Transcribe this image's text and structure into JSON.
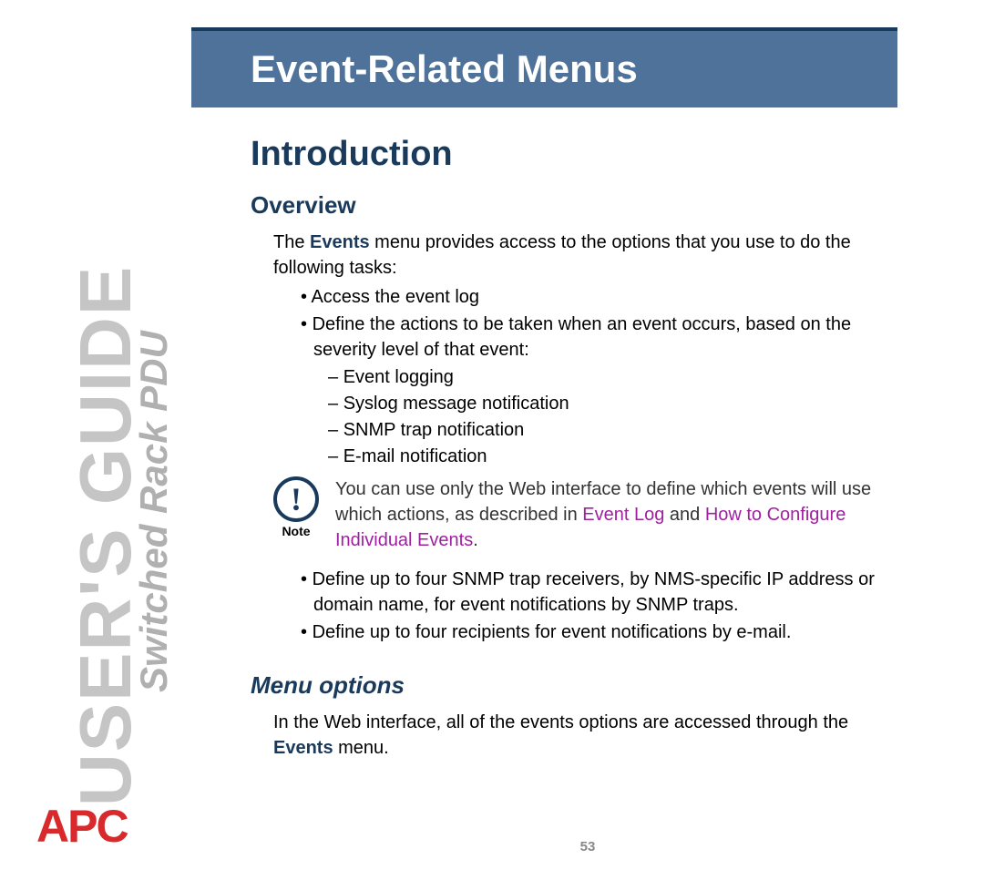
{
  "sidebar": {
    "title_large": "USER'S GUIDE",
    "title_small": "Switched Rack PDU",
    "logo_text": "APC"
  },
  "header": {
    "banner_title": "Event-Related Menus"
  },
  "section": {
    "title": "Introduction",
    "overview_heading": "Overview",
    "overview_intro_prefix": "The ",
    "overview_intro_bold": "Events",
    "overview_intro_suffix": " menu provides access to the options that you use to do the following tasks:",
    "bullets": {
      "b1": "Access the event log",
      "b2": "Define the actions to be taken when an event occurs, based on the severity level of that event:",
      "sub1": "Event logging",
      "sub2": "Syslog message notification",
      "sub3": "SNMP trap notification",
      "sub4": "E-mail notification",
      "b3": "Define up to four SNMP trap receivers, by NMS-specific IP address or domain name, for event notifications by SNMP traps.",
      "b4": "Define up to four recipients for event notifications by e-mail."
    },
    "note": {
      "label": "Note",
      "text_prefix": "You can use only the Web interface to define which events will use which actions, as described in ",
      "link1": "Event Log",
      "text_mid": " and ",
      "link2": "How to Configure Individual Events",
      "text_suffix": "."
    },
    "menu_options_heading": "Menu options",
    "menu_options_prefix": "In the Web interface, all of the events options are accessed through the ",
    "menu_options_bold": "Events",
    "menu_options_suffix": " menu."
  },
  "page_number": "53"
}
